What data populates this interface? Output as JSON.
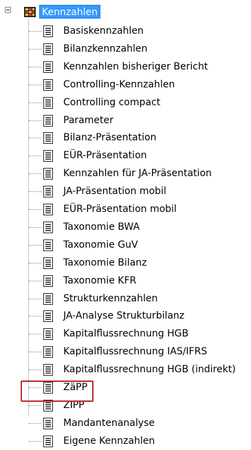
{
  "tree": {
    "root": {
      "label": "Kennzahlen",
      "expanded": true,
      "selected": true
    },
    "items": [
      {
        "label": "Basiskennzahlen"
      },
      {
        "label": "Bilanzkennzahlen"
      },
      {
        "label": "Kennzahlen bisheriger Bericht"
      },
      {
        "label": "Controlling-Kennzahlen"
      },
      {
        "label": "Controlling compact"
      },
      {
        "label": "Parameter"
      },
      {
        "label": "Bilanz-Präsentation"
      },
      {
        "label": "EÜR-Präsentation"
      },
      {
        "label": "Kennzahlen für JA-Präsentation"
      },
      {
        "label": "JA-Präsentation mobil"
      },
      {
        "label": "EÜR-Präsentation mobil"
      },
      {
        "label": "Taxonomie BWA"
      },
      {
        "label": "Taxonomie GuV"
      },
      {
        "label": "Taxonomie Bilanz"
      },
      {
        "label": "Taxonomie KFR"
      },
      {
        "label": "Strukturkennzahlen"
      },
      {
        "label": "JA-Analyse Strukturbilanz"
      },
      {
        "label": "Kapitalflussrechnung HGB"
      },
      {
        "label": "Kapitalflussrechnung IAS/IFRS"
      },
      {
        "label": "Kapitalflussrechnung HGB (indirekt)"
      },
      {
        "label": "ZäPP",
        "highlighted": true
      },
      {
        "label": "ZIPP"
      },
      {
        "label": "Mandantenanalyse"
      },
      {
        "label": "Eigene Kennzahlen"
      }
    ]
  },
  "icons": {
    "root": "grid-folder-icon",
    "item": "document-icon"
  },
  "colors": {
    "selection": "#3399ff",
    "highlight_border": "#c0292d"
  }
}
